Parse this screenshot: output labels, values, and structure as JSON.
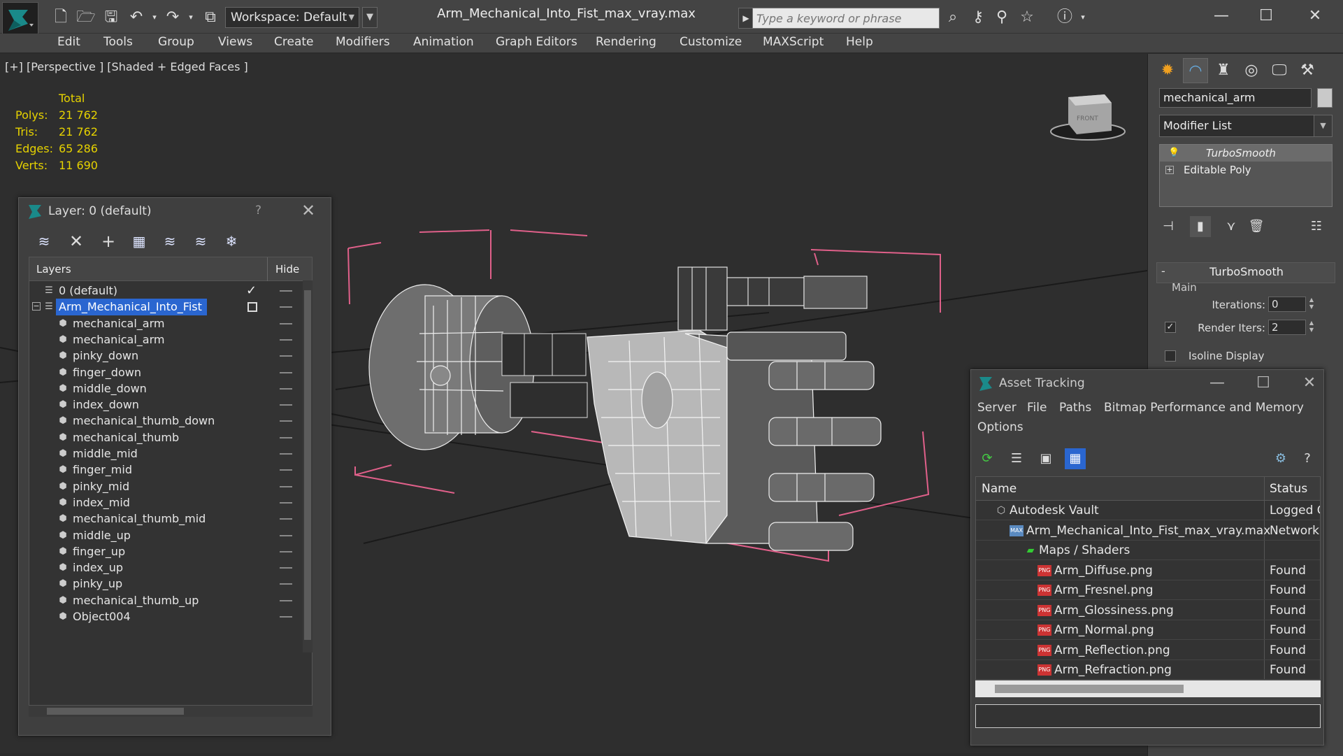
{
  "app": {
    "file_title": "Arm_Mechanical_Into_Fist_max_vray.max",
    "workspace": "Workspace: Default",
    "search_placeholder": "Type a keyword or phrase",
    "accent": "#2a66d0"
  },
  "menu": [
    "Edit",
    "Tools",
    "Group",
    "Views",
    "Create",
    "Modifiers",
    "Animation",
    "Graph Editors",
    "Rendering",
    "Customize",
    "MAXScript",
    "Help"
  ],
  "viewport": {
    "label": "[+] [Perspective ] [Shaded + Edged Faces ]",
    "stats_header": "Total",
    "stats": [
      {
        "label": "Polys:",
        "value": "21 762"
      },
      {
        "label": "Tris:",
        "value": "21 762"
      },
      {
        "label": "Edges:",
        "value": "65 286"
      },
      {
        "label": "Verts:",
        "value": "11 690"
      }
    ],
    "viewcube_label": "FRONT"
  },
  "command_panel": {
    "object_name": "mechanical_arm",
    "modifier_list": "Modifier List",
    "stack": [
      "TurboSmooth",
      "Editable Poly"
    ],
    "rollout_title": "TurboSmooth",
    "rollout_minus": "-",
    "main_label": "Main",
    "iterations_label": "Iterations:",
    "iterations_value": "0",
    "render_iters_label": "Render Iters:",
    "render_iters_value": "2",
    "isoline_label": "Isoline Display"
  },
  "layer_dialog": {
    "title": "Layer: 0 (default)",
    "help": "?",
    "col_layers": "Layers",
    "col_hide": "Hide",
    "rows": [
      {
        "name": "0 (default)"
      },
      {
        "name": "Arm_Mechanical_Into_Fist"
      },
      {
        "name": "mechanical_arm"
      },
      {
        "name": "mechanical_arm"
      },
      {
        "name": "pinky_down"
      },
      {
        "name": "finger_down"
      },
      {
        "name": "middle_down"
      },
      {
        "name": "index_down"
      },
      {
        "name": "mechanical_thumb_down"
      },
      {
        "name": "mechanical_thumb"
      },
      {
        "name": "middle_mid"
      },
      {
        "name": "finger_mid"
      },
      {
        "name": "pinky_mid"
      },
      {
        "name": "index_mid"
      },
      {
        "name": "mechanical_thumb_mid"
      },
      {
        "name": "middle_up"
      },
      {
        "name": "finger_up"
      },
      {
        "name": "index_up"
      },
      {
        "name": "pinky_up"
      },
      {
        "name": "mechanical_thumb_up"
      },
      {
        "name": "Object004"
      }
    ]
  },
  "asset_tracking": {
    "title": "Asset Tracking",
    "menu": [
      "Server",
      "File",
      "Paths",
      "Bitmap Performance and Memory",
      "Options"
    ],
    "col_name": "Name",
    "col_status": "Status",
    "rows": [
      {
        "name": "Autodesk Vault",
        "status": "Logged O"
      },
      {
        "name": "Arm_Mechanical_Into_Fist_max_vray.max",
        "status": "Network"
      },
      {
        "name": "Maps / Shaders",
        "status": ""
      },
      {
        "name": "Arm_Diffuse.png",
        "status": "Found"
      },
      {
        "name": "Arm_Fresnel.png",
        "status": "Found"
      },
      {
        "name": "Arm_Glossiness.png",
        "status": "Found"
      },
      {
        "name": "Arm_Normal.png",
        "status": "Found"
      },
      {
        "name": "Arm_Reflection.png",
        "status": "Found"
      },
      {
        "name": "Arm_Refraction.png",
        "status": "Found"
      }
    ]
  }
}
